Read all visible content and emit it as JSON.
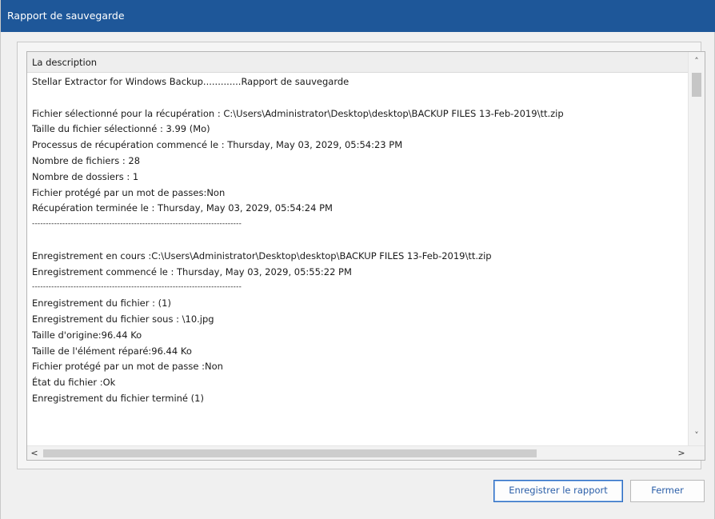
{
  "window": {
    "title": "Rapport de sauvegarde"
  },
  "report": {
    "column_header": "La description",
    "lines": [
      "Stellar Extractor for Windows Backup.............Rapport de sauvegarde",
      "",
      "Fichier sélectionné pour la récupération : C:\\Users\\Administrator\\Desktop\\desktop\\BACKUP FILES 13-Feb-2019\\tt.zip",
      "Taille du fichier sélectionné : 3.99 (Mo)",
      "Processus de récupération commencé le : Thursday, May 03, 2029, 05:54:23 PM",
      "Nombre de fichiers : 28",
      "Nombre de dossiers : 1",
      "Fichier protégé par un mot de passes:Non",
      "Récupération terminée le : Thursday, May 03, 2029, 05:54:24 PM",
      "----------------------------------------------------------------------------",
      "",
      "Enregistrement en cours :C:\\Users\\Administrator\\Desktop\\desktop\\BACKUP FILES 13-Feb-2019\\tt.zip",
      "Enregistrement commencé le : Thursday, May 03, 2029, 05:55:22 PM",
      "----------------------------------------------------------------------------",
      "Enregistrement du fichier : (1)",
      "Enregistrement du fichier sous : \\10.jpg",
      "Taille d'origine:96.44 Ko",
      "Taille de l'élément réparé:96.44 Ko",
      "Fichier protégé par un mot de passe :Non",
      "État du fichier :Ok",
      "Enregistrement du fichier terminé (1)"
    ]
  },
  "scrollbars": {
    "up_arrow": "˄",
    "down_arrow": "˅",
    "left_arrow": "<",
    "right_arrow": ">"
  },
  "buttons": {
    "save_label": "Enregistrer le rapport",
    "close_label": "Fermer"
  },
  "colors": {
    "titlebar": "#1e5799",
    "button_text": "#2a5ea8",
    "focused_button_border": "#2b6cc2"
  }
}
